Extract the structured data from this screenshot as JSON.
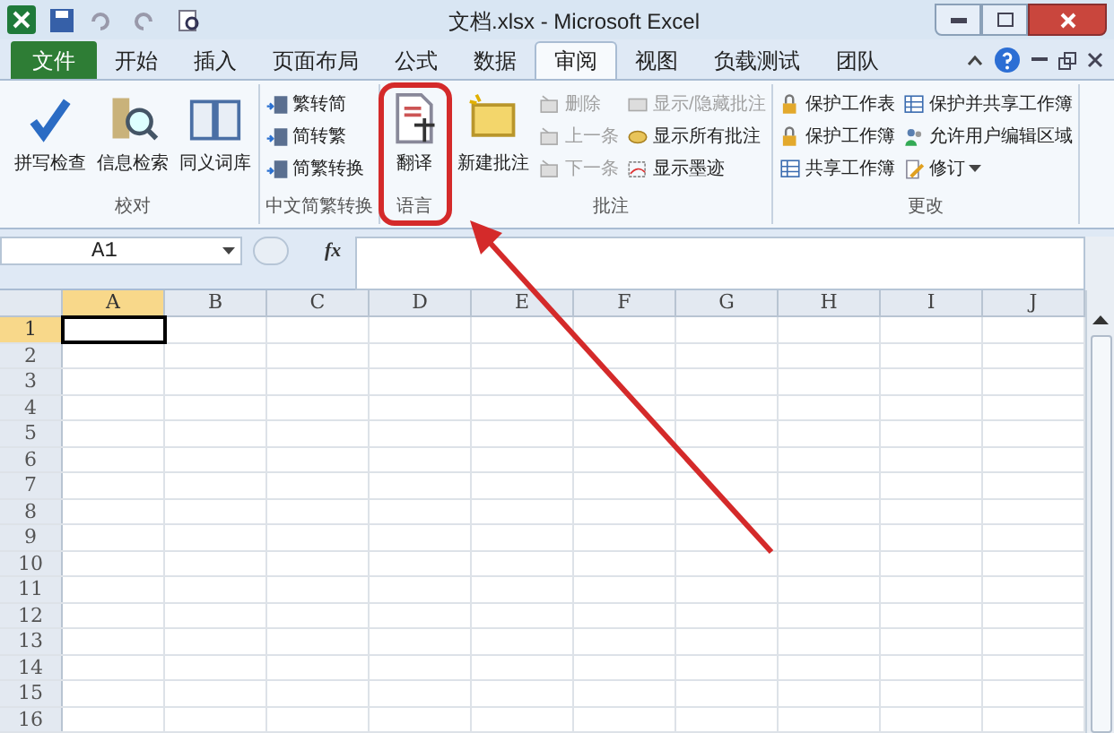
{
  "window": {
    "title": "文档.xlsx - Microsoft Excel"
  },
  "tabs": [
    {
      "label": "文件",
      "kind": "file",
      "selected": false
    },
    {
      "label": "开始",
      "kind": "tab",
      "selected": false
    },
    {
      "label": "插入",
      "kind": "tab",
      "selected": false
    },
    {
      "label": "页面布局",
      "kind": "tab",
      "selected": false
    },
    {
      "label": "公式",
      "kind": "tab",
      "selected": false
    },
    {
      "label": "数据",
      "kind": "tab",
      "selected": false
    },
    {
      "label": "审阅",
      "kind": "tab",
      "selected": true
    },
    {
      "label": "视图",
      "kind": "tab",
      "selected": false
    },
    {
      "label": "负载测试",
      "kind": "tab",
      "selected": false
    },
    {
      "label": "团队",
      "kind": "tab",
      "selected": false
    }
  ],
  "ribbon": {
    "groups": [
      {
        "label": "校对",
        "highlighted": false,
        "items": [
          {
            "kind": "large",
            "label": "拼写检查",
            "disabled": false
          },
          {
            "kind": "large",
            "label": "信息检索",
            "disabled": false
          },
          {
            "kind": "large",
            "label": "同义词库",
            "disabled": false
          }
        ]
      },
      {
        "label": "中文简繁转换",
        "highlighted": false,
        "items": [
          {
            "kind": "small",
            "label": "繁转简",
            "disabled": false
          },
          {
            "kind": "small",
            "label": "简转繁",
            "disabled": false
          },
          {
            "kind": "small",
            "label": "简繁转换",
            "disabled": false
          }
        ]
      },
      {
        "label": "语言",
        "highlighted": true,
        "items": [
          {
            "kind": "large",
            "label": "翻译",
            "disabled": false
          }
        ]
      },
      {
        "label": "批注",
        "highlighted": false,
        "items": [
          {
            "kind": "large",
            "label": "新建批注",
            "disabled": false
          },
          {
            "kind": "small",
            "label": "删除",
            "disabled": true
          },
          {
            "kind": "small",
            "label": "上一条",
            "disabled": true
          },
          {
            "kind": "small",
            "label": "下一条",
            "disabled": true
          },
          {
            "kind": "small",
            "label": "显示/隐藏批注",
            "disabled": true
          },
          {
            "kind": "small",
            "label": "显示所有批注",
            "disabled": false
          },
          {
            "kind": "small",
            "label": "显示墨迹",
            "disabled": false
          }
        ]
      },
      {
        "label": "更改",
        "highlighted": false,
        "items": [
          {
            "kind": "small",
            "label": "保护工作表",
            "disabled": false
          },
          {
            "kind": "small",
            "label": "保护工作簿",
            "disabled": false
          },
          {
            "kind": "small",
            "label": "共享工作簿",
            "disabled": false
          },
          {
            "kind": "small",
            "label": "保护并共享工作簿",
            "disabled": false
          },
          {
            "kind": "small",
            "label": "允许用户编辑区域",
            "disabled": false
          },
          {
            "kind": "dropdown",
            "label": "修订",
            "disabled": false
          }
        ]
      }
    ]
  },
  "formula_bar": {
    "name_box": "A1",
    "fx": "fx"
  },
  "sheet": {
    "columns": [
      {
        "label": "A",
        "selected": true
      },
      {
        "label": "B",
        "selected": false
      },
      {
        "label": "C",
        "selected": false
      },
      {
        "label": "D",
        "selected": false
      },
      {
        "label": "E",
        "selected": false
      },
      {
        "label": "F",
        "selected": false
      },
      {
        "label": "G",
        "selected": false
      },
      {
        "label": "H",
        "selected": false
      },
      {
        "label": "I",
        "selected": false
      },
      {
        "label": "J",
        "selected": false
      }
    ],
    "rows": [
      {
        "label": "1",
        "selected": true
      },
      {
        "label": "2",
        "selected": false
      },
      {
        "label": "3",
        "selected": false
      },
      {
        "label": "4",
        "selected": false
      },
      {
        "label": "5",
        "selected": false
      },
      {
        "label": "6",
        "selected": false
      },
      {
        "label": "7",
        "selected": false
      },
      {
        "label": "8",
        "selected": false
      },
      {
        "label": "9",
        "selected": false
      },
      {
        "label": "10",
        "selected": false
      },
      {
        "label": "11",
        "selected": false
      },
      {
        "label": "12",
        "selected": false
      },
      {
        "label": "13",
        "selected": false
      },
      {
        "label": "14",
        "selected": false
      },
      {
        "label": "15",
        "selected": false
      },
      {
        "label": "16",
        "selected": false
      }
    ]
  }
}
